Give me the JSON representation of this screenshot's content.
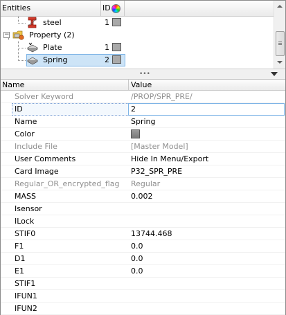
{
  "tree": {
    "headers": {
      "name": "Entities",
      "id": "ID"
    },
    "rows": [
      {
        "label": "steel",
        "id": "1"
      },
      {
        "label": "Property (2)"
      },
      {
        "label": "Plate",
        "id": "1"
      },
      {
        "label": "Spring",
        "id": "2"
      }
    ],
    "splitter_grip": "•••"
  },
  "grid": {
    "headers": {
      "name": "Name",
      "value": "Value"
    },
    "rows": [
      {
        "name": "Solver Keyword",
        "value": "/PROP/SPR_PRE/"
      },
      {
        "name": "ID",
        "value": "2"
      },
      {
        "name": "Name",
        "value": "Spring"
      },
      {
        "name": "Color",
        "value": ""
      },
      {
        "name": "Include File",
        "value": "[Master Model]"
      },
      {
        "name": "User Comments",
        "value": "Hide In Menu/Export"
      },
      {
        "name": "Card Image",
        "value": "P32_SPR_PRE"
      },
      {
        "name": "Regular_OR_encrypted_flag",
        "value": "Regular"
      },
      {
        "name": "MASS",
        "value": "0.002"
      },
      {
        "name": "Isensor",
        "value": ""
      },
      {
        "name": "ILock",
        "value": ""
      },
      {
        "name": "STIF0",
        "value": "13744.468"
      },
      {
        "name": "F1",
        "value": "0.0"
      },
      {
        "name": "D1",
        "value": "0.0"
      },
      {
        "name": "E1",
        "value": "0.0"
      },
      {
        "name": "STIF1",
        "value": ""
      },
      {
        "name": "IFUN1",
        "value": ""
      },
      {
        "name": "IFUN2",
        "value": ""
      }
    ]
  },
  "colors": {
    "selection_fill": "#cde4f7",
    "selection_border": "#7eb4e6",
    "readonly_text": "#8e8e8e",
    "entity_swatch": "#a9a9a9"
  }
}
